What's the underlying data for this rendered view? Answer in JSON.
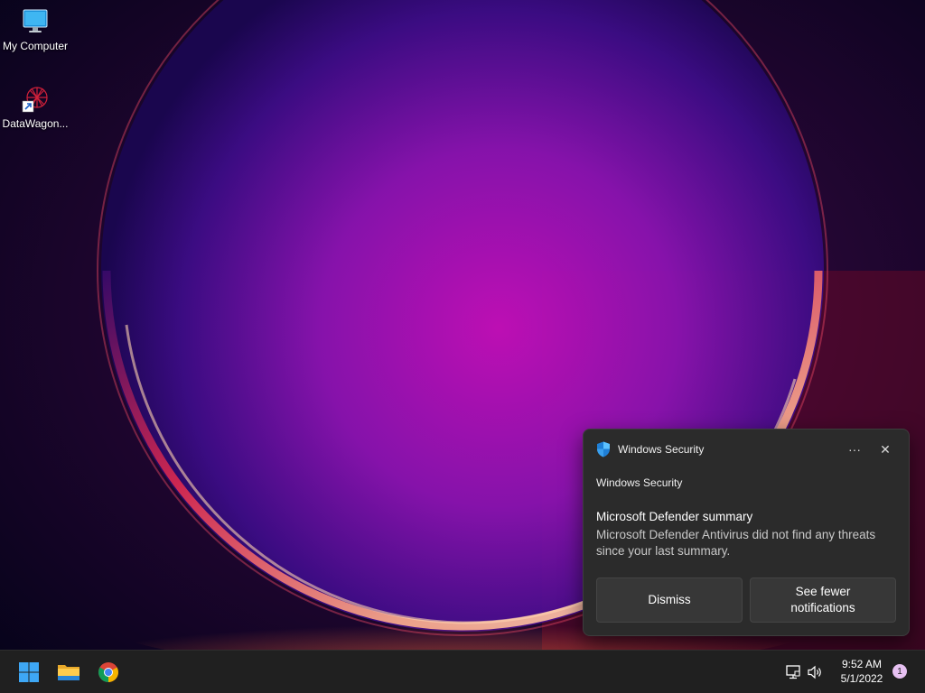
{
  "desktop": {
    "icons": [
      {
        "label": "My Computer",
        "icon": "monitor-icon"
      },
      {
        "label": "DataWagon...",
        "icon": "datawagon-shortcut-icon"
      }
    ]
  },
  "toast": {
    "app_name": "Windows Security",
    "app_icon": "windows-security-shield-icon",
    "more_label": "···",
    "close_label": "✕",
    "attribution": "Windows Security",
    "title": "Microsoft Defender summary",
    "body": "Microsoft Defender Antivirus did not find any threats since your last summary.",
    "actions": [
      {
        "label": "Dismiss"
      },
      {
        "label": "See fewer notifications"
      }
    ]
  },
  "taskbar": {
    "apps": [
      {
        "icon": "windows-start-icon"
      },
      {
        "icon": "file-explorer-icon"
      },
      {
        "icon": "chrome-icon"
      }
    ],
    "tray": {
      "network_icon": "network-icon",
      "volume_icon": "volume-icon",
      "time": "9:52 AM",
      "date": "5/1/2022",
      "notification_count": "1"
    }
  },
  "colors": {
    "taskbar_bg": "#202020",
    "toast_bg": "#2b2b2b",
    "toast_button_bg": "#373737",
    "badge_bg": "#e7c1f2",
    "start_blue": "#3ea7f5"
  }
}
